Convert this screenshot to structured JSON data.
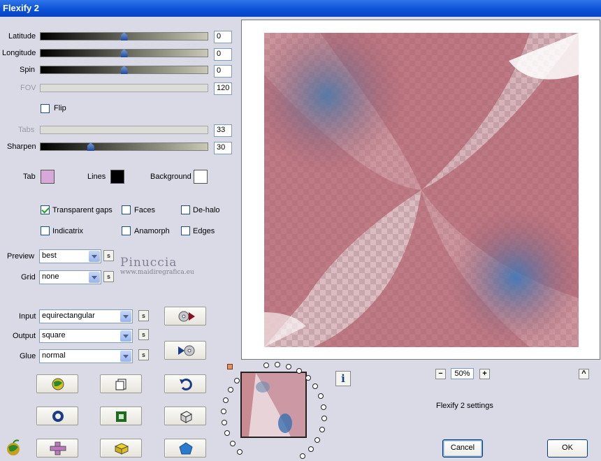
{
  "window": {
    "title": "Flexify 2"
  },
  "params": {
    "latitude": {
      "label": "Latitude",
      "value": "0",
      "fraction": 0.5
    },
    "longitude": {
      "label": "Longitude",
      "value": "0",
      "fraction": 0.5
    },
    "spin": {
      "label": "Spin",
      "value": "0",
      "fraction": 0.5
    },
    "fov": {
      "label": "FOV",
      "value": "120"
    },
    "tabs": {
      "label": "Tabs",
      "value": "33"
    },
    "sharpen": {
      "label": "Sharpen",
      "value": "30",
      "fraction": 0.3
    }
  },
  "flip_label": "Flip",
  "colors": {
    "tab_label": "Tab",
    "tab_color": "#d8a8d8",
    "lines_label": "Lines",
    "lines_color": "#000000",
    "background_label": "Background",
    "background_color": "#ffffff"
  },
  "options": {
    "transparent_gaps": {
      "label": "Transparent gaps",
      "checked": true
    },
    "faces": {
      "label": "Faces",
      "checked": false
    },
    "de_halo": {
      "label": "De-halo",
      "checked": false
    },
    "indicatrix": {
      "label": "Indicatrix",
      "checked": false
    },
    "anamorph": {
      "label": "Anamorph",
      "checked": false
    },
    "edges": {
      "label": "Edges",
      "checked": false
    }
  },
  "selects": {
    "preview": {
      "label": "Preview",
      "value": "best"
    },
    "grid": {
      "label": "Grid",
      "value": "none"
    },
    "input": {
      "label": "Input",
      "value": "equirectangular"
    },
    "output": {
      "label": "Output",
      "value": "square"
    },
    "glue": {
      "label": "Glue",
      "value": "normal"
    }
  },
  "s_button_label": "s",
  "watermark": {
    "line1": "Pinuccia",
    "line2": "www.maidiregrafica.eu"
  },
  "zoom": {
    "minus": "−",
    "value": "50%",
    "plus": "+"
  },
  "up_label": "^",
  "info_label": "i",
  "settings_label": "Flexify 2 settings",
  "buttons": {
    "cancel": "Cancel",
    "ok": "OK"
  }
}
